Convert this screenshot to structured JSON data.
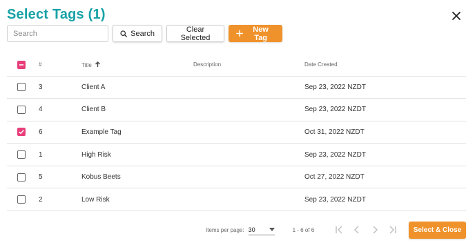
{
  "dialog": {
    "title": "Select Tags (1)",
    "close_icon": "close-icon"
  },
  "toolbar": {
    "search_placeholder": "Search",
    "search_value": "",
    "search_button": "Search",
    "clear_button": "Clear Selected",
    "new_tag_button": "New Tag"
  },
  "table": {
    "columns": [
      "#",
      "Title",
      "Description",
      "Date Created"
    ],
    "sort": {
      "column": "Title",
      "direction": "ascending"
    },
    "header_checkbox": "indeterminate",
    "rows": [
      {
        "id": "3",
        "title": "Client A",
        "description": "",
        "date": "Sep 23, 2022 NZDT",
        "checked": false
      },
      {
        "id": "4",
        "title": "Client B",
        "description": "",
        "date": "Sep 23, 2022 NZDT",
        "checked": false
      },
      {
        "id": "6",
        "title": "Example Tag",
        "description": "",
        "date": "Oct 31, 2022 NZDT",
        "checked": true
      },
      {
        "id": "1",
        "title": "High Risk",
        "description": "",
        "date": "Sep 23, 2022 NZDT",
        "checked": false
      },
      {
        "id": "5",
        "title": "Kobus Beets",
        "description": "",
        "date": "Oct 27, 2022 NZDT",
        "checked": false
      },
      {
        "id": "2",
        "title": "Low Risk",
        "description": "",
        "date": "Sep 23, 2022 NZDT",
        "checked": false
      }
    ]
  },
  "pagination": {
    "items_per_page_label": "Items per page:",
    "items_per_page": "30",
    "range": "1 - 6 of 6"
  },
  "footer": {
    "select_close": "Select & Close"
  },
  "colors": {
    "title": "#17a2a6",
    "accent_orange": "#f0922b",
    "checkbox_pink": "#e83e7a"
  }
}
